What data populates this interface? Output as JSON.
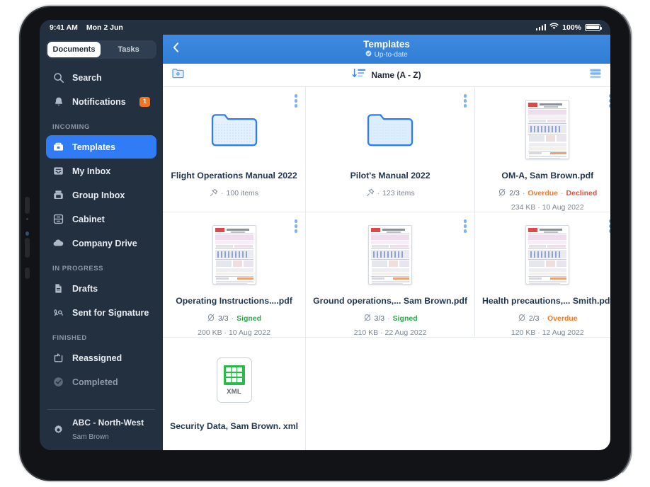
{
  "status_bar": {
    "time": "9:41 AM",
    "date": "Mon 2 Jun",
    "battery_percent": "100%",
    "wifi_icon": "wifi-icon",
    "cellular_icon": "cellular-signal-icon",
    "battery_icon": "battery-full-icon"
  },
  "sidebar": {
    "segmented": {
      "options": [
        "Documents",
        "Tasks"
      ],
      "selected": "Documents"
    },
    "top_items": [
      {
        "label": "Search",
        "icon": "search-icon"
      },
      {
        "label": "Notifications",
        "icon": "bell-icon",
        "badge": "1"
      }
    ],
    "sections": [
      {
        "header": "INCOMING",
        "items": [
          {
            "label": "Templates",
            "icon": "toolbox-icon",
            "selected": true
          },
          {
            "label": "My Inbox",
            "icon": "inbox-tray-icon",
            "selected": false
          },
          {
            "label": "Group Inbox",
            "icon": "group-inbox-icon",
            "selected": false
          },
          {
            "label": "Cabinet",
            "icon": "file-cabinet-icon",
            "selected": false
          },
          {
            "label": "Company Drive",
            "icon": "cloud-icon",
            "selected": false
          }
        ]
      },
      {
        "header": "IN PROGRESS",
        "items": [
          {
            "label": "Drafts",
            "icon": "document-icon",
            "selected": false
          },
          {
            "label": "Sent for Signature",
            "icon": "signature-icon",
            "selected": false
          }
        ]
      },
      {
        "header": "FINISHED",
        "items": [
          {
            "label": "Reassigned",
            "icon": "reassign-tray-icon",
            "selected": false
          },
          {
            "label": "Completed",
            "icon": "check-circle-icon",
            "selected": false,
            "dim": true
          }
        ]
      }
    ],
    "profile": {
      "icon": "gear-icon",
      "name": "ABC - North-West",
      "subtitle": "Sam Brown"
    }
  },
  "navbar": {
    "back_icon": "chevron-left-icon",
    "title": "Templates",
    "sync_icon": "check-circle-filled-icon",
    "sync_status": "Up-to-date"
  },
  "toolbar": {
    "new_folder_icon": "new-folder-icon",
    "sort_icon": "sort-descending-icon",
    "sort_label": "Name (A - Z)",
    "view_toggle_icon": "list-view-icon"
  },
  "colors": {
    "accent_blue": "#2f7cf6",
    "navbar_blue": "#3f8ae0",
    "sidebar_dark": "#233040",
    "badge_orange": "#f47321",
    "status_signed": "#2aa84a",
    "status_overdue": "#f07a2a",
    "status_declined": "#e8503a",
    "xml_green": "#2db84c"
  },
  "grid": {
    "items": [
      {
        "kind": "folder",
        "name": "Flight Operations Manual 2022",
        "meta_icon": "pin-icon",
        "meta_sep": "·",
        "count": "100 items",
        "size_line": ""
      },
      {
        "kind": "folder",
        "name": "Pilot's Manual 2022",
        "meta_icon": "pin-icon",
        "meta_sep": "·",
        "count": "123 items",
        "size_line": ""
      },
      {
        "kind": "pdf",
        "name": "OM-A, Sam Brown.pdf",
        "meta_icon": "signature-pen-icon",
        "signatures": "2/3",
        "statuses": [
          {
            "text": "Overdue",
            "style": "overdue"
          },
          {
            "text": "Declined",
            "style": "declined"
          }
        ],
        "size_line": "234 KB · 10 Aug 2022"
      },
      {
        "kind": "pdf",
        "name": "Operating Instructions....pdf",
        "meta_icon": "signature-pen-icon",
        "signatures": "3/3",
        "statuses": [
          {
            "text": "Signed",
            "style": "signed"
          }
        ],
        "size_line": "200 KB · 10 Aug 2022"
      },
      {
        "kind": "pdf",
        "name": "Ground operations,... Sam Brown.pdf",
        "meta_icon": "signature-pen-icon",
        "signatures": "3/3",
        "statuses": [
          {
            "text": "Signed",
            "style": "signed"
          }
        ],
        "size_line": "210 KB · 22 Aug 2022"
      },
      {
        "kind": "pdf",
        "name": "Health precautions,... Smith.pdf",
        "meta_icon": "signature-pen-icon",
        "signatures": "2/3",
        "statuses": [
          {
            "text": "Overdue",
            "style": "overdue"
          }
        ],
        "size_line": "120 KB · 12 Aug 2022"
      },
      {
        "kind": "xml",
        "name": "Security Data, Sam Brown. xml",
        "xml_label": "XML",
        "size_line": ""
      }
    ]
  }
}
